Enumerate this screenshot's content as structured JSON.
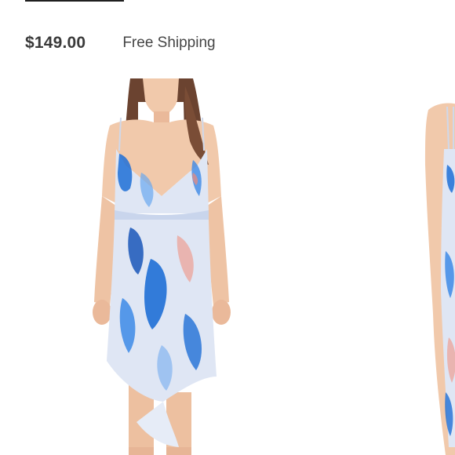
{
  "product": {
    "price": "$149.00",
    "shipping": "Free Shipping"
  },
  "gallery": {
    "images": [
      {
        "alt": "dress-model-front",
        "icon": "product-photo"
      },
      {
        "alt": "dress-model-side",
        "icon": "product-photo"
      }
    ]
  },
  "colors": {
    "price_text": "#3a3a3a",
    "body_text": "#454545",
    "dress_base": "#dfe6f4",
    "dress_blue": "#1f6fd6",
    "skin": "#f1c9ab",
    "hair": "#6b4330"
  }
}
